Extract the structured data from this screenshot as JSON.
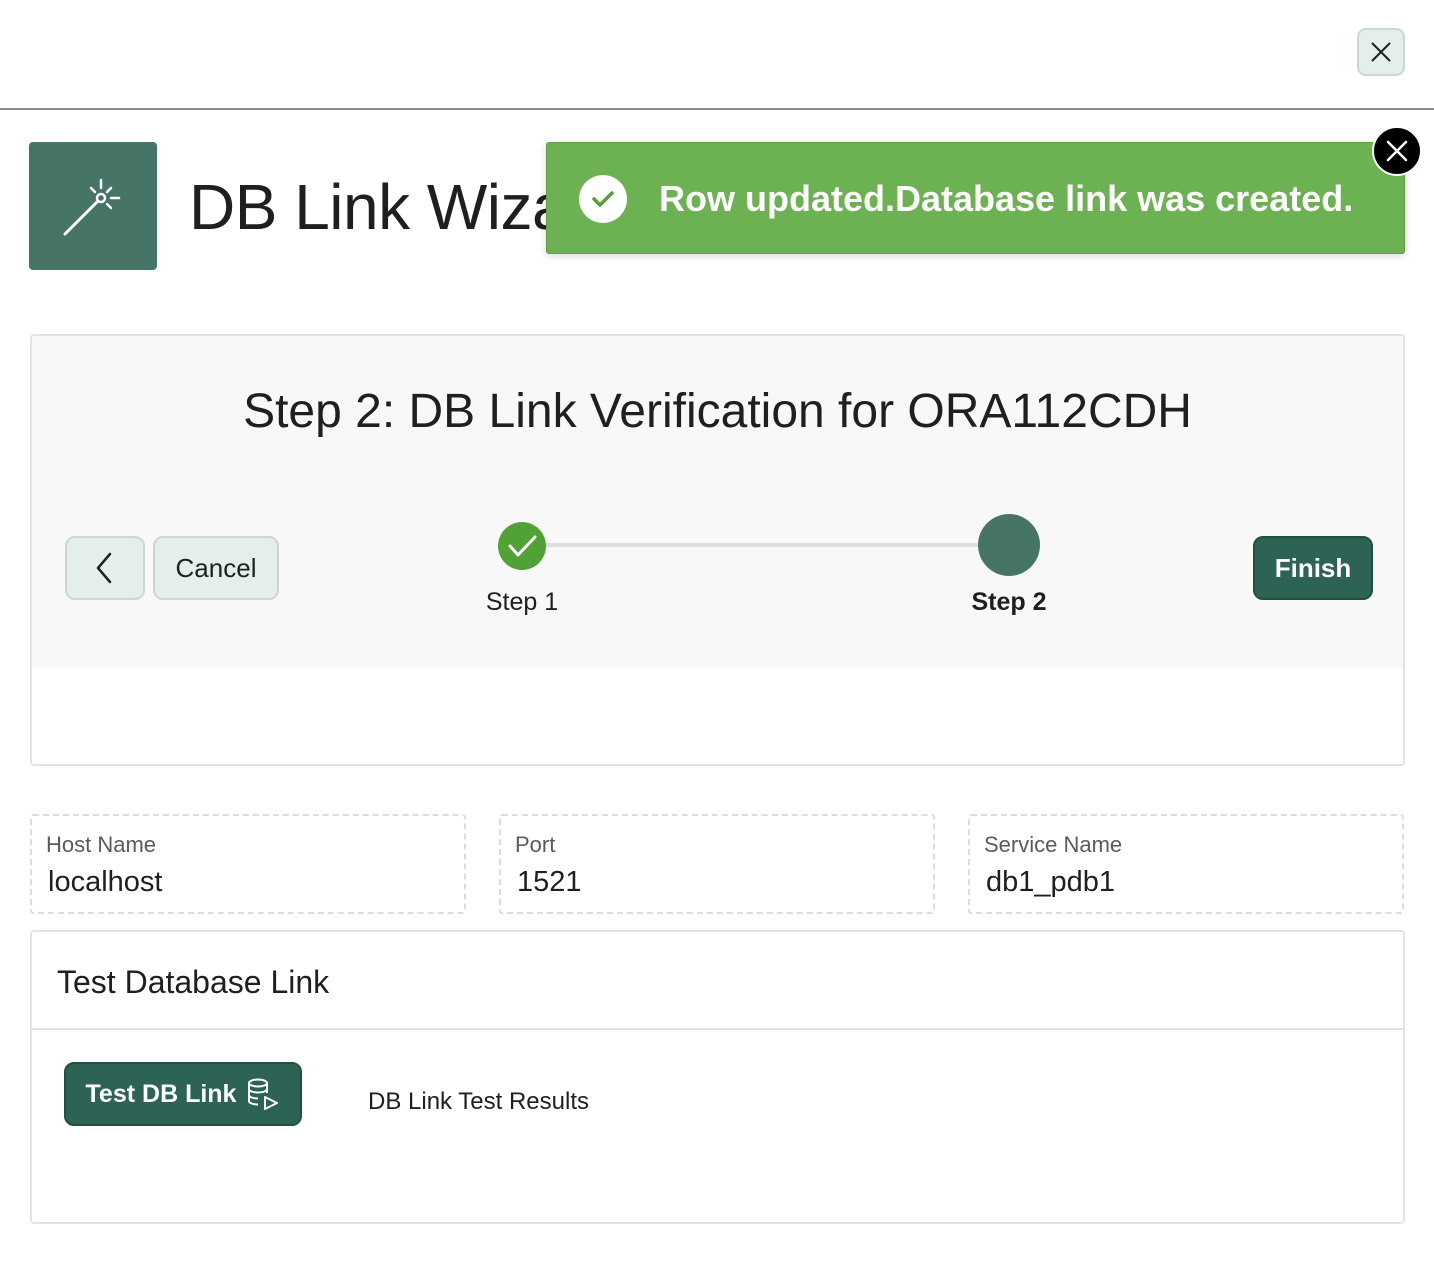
{
  "dialog": {
    "close_icon": "close-icon"
  },
  "header": {
    "title": "DB Link Wizard",
    "icon": "magic-wand-icon",
    "accent_color": "#467567"
  },
  "toast": {
    "message": "Row updated.Database link was created.",
    "icon": "success-check-icon",
    "close_icon": "close-icon",
    "color": "#6cb152"
  },
  "wizard": {
    "step_title": "Step 2: DB Link Verification for ORA112CDH",
    "prev_icon": "chevron-left-icon",
    "cancel_label": "Cancel",
    "finish_label": "Finish",
    "steps": [
      {
        "label": "Step 1",
        "state": "complete"
      },
      {
        "label": "Step 2",
        "state": "current"
      }
    ]
  },
  "fields": {
    "host": {
      "label": "Host Name",
      "value": "localhost"
    },
    "port": {
      "label": "Port",
      "value": "1521"
    },
    "service": {
      "label": "Service Name",
      "value": "db1_pdb1"
    }
  },
  "test_panel": {
    "title": "Test Database Link",
    "button_label": "Test DB Link",
    "button_icon": "database-run-icon",
    "results_label": "DB Link Test Results"
  },
  "colors": {
    "primary": "#2c6355",
    "success": "#52a135",
    "secondary_button": "#e4efec"
  }
}
